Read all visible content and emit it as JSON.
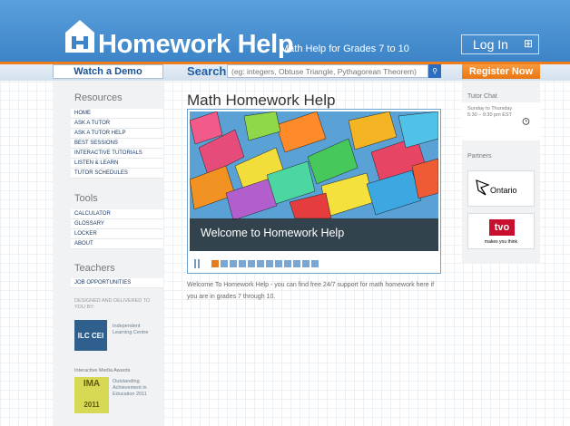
{
  "header": {
    "logo_text": "Homework Help",
    "tagline": "Math Help for Grades 7 to 10",
    "login_label": "Log In",
    "login_icon": "plus-square-icon",
    "brand_color": "#3d84c8",
    "accent_color": "#f07d1a"
  },
  "subbar": {
    "watch_demo_label": "Watch a Demo",
    "search_label": "Search",
    "search_placeholder": "(eg: integers, Obtuse Triangle, Pythagorean Theorem)",
    "search_icon": "search-icon",
    "register_label": "Register Now"
  },
  "sidebar": {
    "resources_title": "Resources",
    "resources": [
      "HOME",
      "ASK A TUTOR",
      "ASK A TUTOR HELP",
      "BEST SESSIONS",
      "INTERACTIVE TUTORIALS",
      "LISTEN & LEARN",
      "TUTOR SCHEDULES"
    ],
    "tools_title": "Tools",
    "tools": [
      "CALCULATOR",
      "GLOSSARY",
      "LOCKER",
      "ABOUT"
    ],
    "teachers_title": "Teachers",
    "teachers": [
      "JOB OPPORTUNITIES"
    ],
    "designed_by": "DESIGNED AND DELIVERED TO YOU BY:",
    "ilc_logo": "ILC CEI",
    "ilc_name": "Independent Learning Centre",
    "ima_title": "Interactive Media Awards",
    "ima_logo": "IMA",
    "ima_winner": "WINNER",
    "ima_year": "2011",
    "ima_text": "Outstanding Achievement in Education 2011"
  },
  "main": {
    "title": "Math Homework Help",
    "slide_caption": "Welcome to Homework Help",
    "slide_count": 12,
    "active_slide": 1,
    "intro": "Welcome To Homework Help - you can find free 24/7 support for math homework here if you are in grades 7 through 10."
  },
  "right": {
    "tutor_chat_title": "Tutor Chat",
    "tutor_chat_hours": "Sunday to Thursday 5:30 – 9:30 pm EST",
    "clock_icon": "clock-icon",
    "partners_title": "Partners",
    "ontario_text": "Ontario",
    "tvo_text": "tvo",
    "tvo_tagline": "makes you think"
  }
}
